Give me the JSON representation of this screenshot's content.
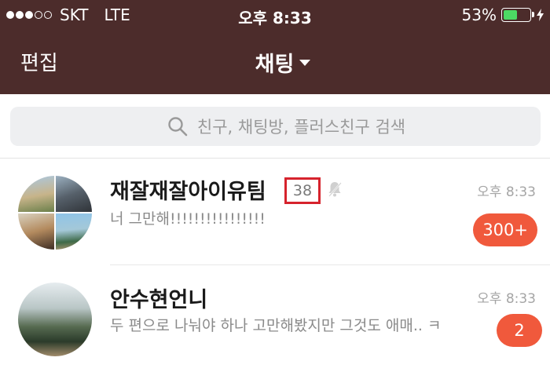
{
  "status_bar": {
    "carrier": "SKT",
    "network": "LTE",
    "time": "오후 8:33",
    "battery_percent": "53%",
    "battery_level": 0.53,
    "signal_bars_filled": 3,
    "signal_bars_total": 5
  },
  "nav": {
    "edit_label": "편집",
    "title": "채팅"
  },
  "search": {
    "placeholder": "친구, 채팅방, 플러스친구 검색"
  },
  "colors": {
    "header_bg": "#4c2c2b",
    "badge_bg": "#f0593c",
    "highlight_box": "#d6232d",
    "battery_fill": "#4cd964"
  },
  "chats": [
    {
      "name": "재잘재잘아이유팀",
      "member_count": "38",
      "muted": true,
      "preview": "너 그만해!!!!!!!!!!!!!!!!",
      "time": "오후 8:33",
      "unread": "300+",
      "avatar": "group-photo-collage"
    },
    {
      "name": "안수현언니",
      "preview": "두 편으로 나눠야 하나 고만해봤지만 그것도 애매.. ㅋ",
      "time": "오후 8:33",
      "unread": "2",
      "avatar": "profile-photo"
    }
  ]
}
